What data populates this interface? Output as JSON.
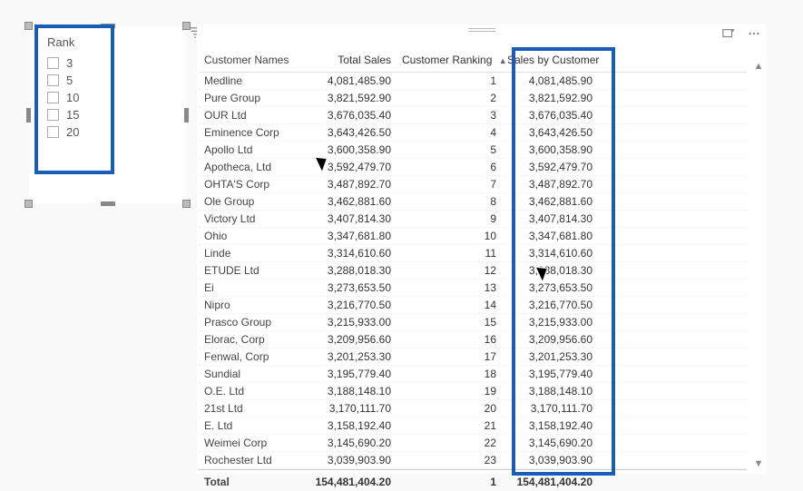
{
  "slicer": {
    "title": "Rank",
    "items": [
      {
        "label": "3",
        "checked": false
      },
      {
        "label": "5",
        "checked": false
      },
      {
        "label": "10",
        "checked": false
      },
      {
        "label": "15",
        "checked": false
      },
      {
        "label": "20",
        "checked": false
      }
    ]
  },
  "table": {
    "headers": {
      "customer": "Customer Names",
      "totalSales": "Total Sales",
      "ranking": "Customer Ranking",
      "salesBy": "Sales by Customer"
    },
    "sortColumn": "ranking",
    "sortDirection": "asc",
    "rows": [
      {
        "customer": "Medline",
        "totalSales": "4,081,485.90",
        "rank": "1",
        "salesBy": "4,081,485.90"
      },
      {
        "customer": "Pure Group",
        "totalSales": "3,821,592.90",
        "rank": "2",
        "salesBy": "3,821,592.90"
      },
      {
        "customer": "OUR Ltd",
        "totalSales": "3,676,035.40",
        "rank": "3",
        "salesBy": "3,676,035.40"
      },
      {
        "customer": "Eminence Corp",
        "totalSales": "3,643,426.50",
        "rank": "4",
        "salesBy": "3,643,426.50"
      },
      {
        "customer": "Apollo Ltd",
        "totalSales": "3,600,358.90",
        "rank": "5",
        "salesBy": "3,600,358.90"
      },
      {
        "customer": "Apotheca, Ltd",
        "totalSales": "3,592,479.70",
        "rank": "6",
        "salesBy": "3,592,479.70"
      },
      {
        "customer": "OHTA'S Corp",
        "totalSales": "3,487,892.70",
        "rank": "7",
        "salesBy": "3,487,892.70"
      },
      {
        "customer": "Ole Group",
        "totalSales": "3,462,881.60",
        "rank": "8",
        "salesBy": "3,462,881.60"
      },
      {
        "customer": "Victory Ltd",
        "totalSales": "3,407,814.30",
        "rank": "9",
        "salesBy": "3,407,814.30"
      },
      {
        "customer": "Ohio",
        "totalSales": "3,347,681.80",
        "rank": "10",
        "salesBy": "3,347,681.80"
      },
      {
        "customer": "Linde",
        "totalSales": "3,314,610.60",
        "rank": "11",
        "salesBy": "3,314,610.60"
      },
      {
        "customer": "ETUDE Ltd",
        "totalSales": "3,288,018.30",
        "rank": "12",
        "salesBy": "3,288,018.30"
      },
      {
        "customer": "Ei",
        "totalSales": "3,273,653.50",
        "rank": "13",
        "salesBy": "3,273,653.50"
      },
      {
        "customer": "Nipro",
        "totalSales": "3,216,770.50",
        "rank": "14",
        "salesBy": "3,216,770.50"
      },
      {
        "customer": "Prasco Group",
        "totalSales": "3,215,933.00",
        "rank": "15",
        "salesBy": "3,215,933.00"
      },
      {
        "customer": "Elorac, Corp",
        "totalSales": "3,209,956.60",
        "rank": "16",
        "salesBy": "3,209,956.60"
      },
      {
        "customer": "Fenwal, Corp",
        "totalSales": "3,201,253.30",
        "rank": "17",
        "salesBy": "3,201,253.30"
      },
      {
        "customer": "Sundial",
        "totalSales": "3,195,779.40",
        "rank": "18",
        "salesBy": "3,195,779.40"
      },
      {
        "customer": "O.E. Ltd",
        "totalSales": "3,188,148.10",
        "rank": "19",
        "salesBy": "3,188,148.10"
      },
      {
        "customer": "21st Ltd",
        "totalSales": "3,170,111.70",
        "rank": "20",
        "salesBy": "3,170,111.70"
      },
      {
        "customer": "E. Ltd",
        "totalSales": "3,158,192.40",
        "rank": "21",
        "salesBy": "3,158,192.40"
      },
      {
        "customer": "Weimei Corp",
        "totalSales": "3,145,690.20",
        "rank": "22",
        "salesBy": "3,145,690.20"
      },
      {
        "customer": "Rochester Ltd",
        "totalSales": "3,039,903.90",
        "rank": "23",
        "salesBy": "3,039,903.90"
      }
    ],
    "total": {
      "label": "Total",
      "totalSales": "154,481,404.20",
      "rank": "1",
      "salesBy": "154,481,404.20"
    }
  }
}
